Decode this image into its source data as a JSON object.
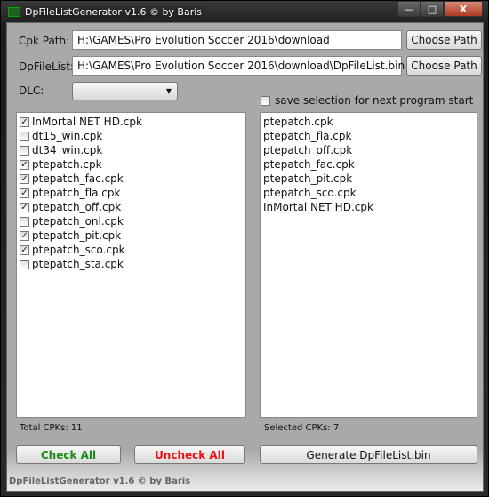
{
  "window": {
    "title": "DpFileListGenerator v1.6 © by Baris",
    "minimize": "—",
    "maximize": "□",
    "close": "X"
  },
  "cpk_path": {
    "label": "Cpk Path:",
    "value": "H:\\GAMES\\Pro Evolution Soccer 2016\\download",
    "button": "Choose Path"
  },
  "dpfilelist": {
    "label": "DpFileList:",
    "value": "H:\\GAMES\\Pro Evolution Soccer 2016\\download\\DpFileList.bin",
    "button": "Choose Path"
  },
  "dlc": {
    "label": "DLC:",
    "value": ""
  },
  "save_selection": {
    "label": "save selection for next program start",
    "checked": false
  },
  "cpk_list": [
    {
      "name": "InMortal NET HD.cpk",
      "checked": true
    },
    {
      "name": "dt15_win.cpk",
      "checked": false
    },
    {
      "name": "dt34_win.cpk",
      "checked": false
    },
    {
      "name": "ptepatch.cpk",
      "checked": true
    },
    {
      "name": "ptepatch_fac.cpk",
      "checked": true
    },
    {
      "name": "ptepatch_fla.cpk",
      "checked": true
    },
    {
      "name": "ptepatch_off.cpk",
      "checked": true
    },
    {
      "name": "ptepatch_onl.cpk",
      "checked": false
    },
    {
      "name": "ptepatch_pit.cpk",
      "checked": true
    },
    {
      "name": "ptepatch_sco.cpk",
      "checked": true
    },
    {
      "name": "ptepatch_sta.cpk",
      "checked": false
    }
  ],
  "selected_list": [
    "ptepatch.cpk",
    "ptepatch_fla.cpk",
    "ptepatch_off.cpk",
    "ptepatch_fac.cpk",
    "ptepatch_pit.cpk",
    "ptepatch_sco.cpk",
    "InMortal NET HD.cpk"
  ],
  "total_label": "Total CPKs: 11",
  "selected_label": "Selected CPKs: 7",
  "buttons": {
    "check_all": "Check All",
    "uncheck_all": "Uncheck All",
    "generate": "Generate DpFileList.bin"
  },
  "colors": {
    "check_all": "#1a8a1a",
    "uncheck_all": "#ee1111"
  },
  "footer": "DpFileListGenerator v1.6 © by Baris"
}
